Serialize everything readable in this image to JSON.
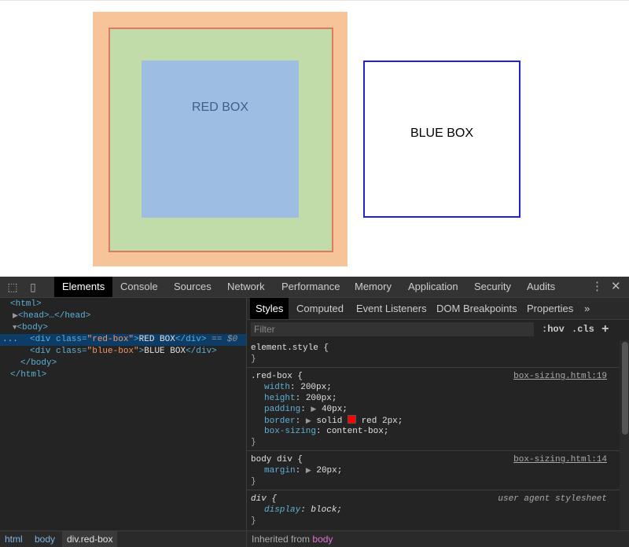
{
  "page": {
    "red_box_label": "RED BOX",
    "blue_box_label": "BLUE BOX"
  },
  "devtools": {
    "tabs": [
      "Elements",
      "Console",
      "Sources",
      "Network",
      "Performance",
      "Memory",
      "Application",
      "Security",
      "Audits"
    ],
    "active_tab": "Elements",
    "elements": {
      "html_open": "<html>",
      "head_line": "<head>…</head>",
      "body_open": "<body>",
      "div_red_open": "<div class=",
      "div_red_class": "\"red-box\"",
      "div_red_gt": ">",
      "div_red_text": "RED BOX",
      "div_red_close": "</div>",
      "selected_marker": "== $0",
      "div_blue_open": "<div class=",
      "div_blue_class": "\"blue-box\"",
      "div_blue_gt": ">",
      "div_blue_text": "BLUE BOX",
      "div_blue_close": "</div>",
      "body_close": "</body>",
      "html_close": "</html>",
      "dots": "..."
    },
    "styles_tabs": [
      "Styles",
      "Computed",
      "Event Listeners",
      "DOM Breakpoints",
      "Properties"
    ],
    "styles_more": "»",
    "filter_placeholder": "Filter",
    "hov": ":hov",
    "cls": ".cls",
    "plus": "+",
    "rules": {
      "element_style": "element.style {",
      "close": "}",
      "red_selector": ".red-box {",
      "red_source": "box-sizing.html:19",
      "width_prop": "width",
      "width_val": "200px;",
      "height_prop": "height",
      "height_val": "200px;",
      "padding_prop": "padding",
      "padding_val": "40px;",
      "border_prop": "border",
      "border_val_a": "solid",
      "border_val_b": "red 2px;",
      "boxsizing_prop": "box-sizing",
      "boxsizing_val": "content-box;",
      "body_div_selector": "body div {",
      "body_div_source": "box-sizing.html:14",
      "margin_prop": "margin",
      "margin_val": "20px;",
      "div_selector": "div {",
      "div_source": "user agent stylesheet",
      "display_prop": "display",
      "display_val": "block;"
    },
    "breadcrumbs": [
      "html",
      "body",
      "div.red-box"
    ],
    "inherited_label": "Inherited from",
    "inherited_from": "body"
  },
  "colors": {
    "margin": "#f7c49a",
    "padding": "#c1dba9",
    "content": "#9dbde3",
    "blue_border": "#2121d6",
    "swatch_red": "#ff0000"
  }
}
